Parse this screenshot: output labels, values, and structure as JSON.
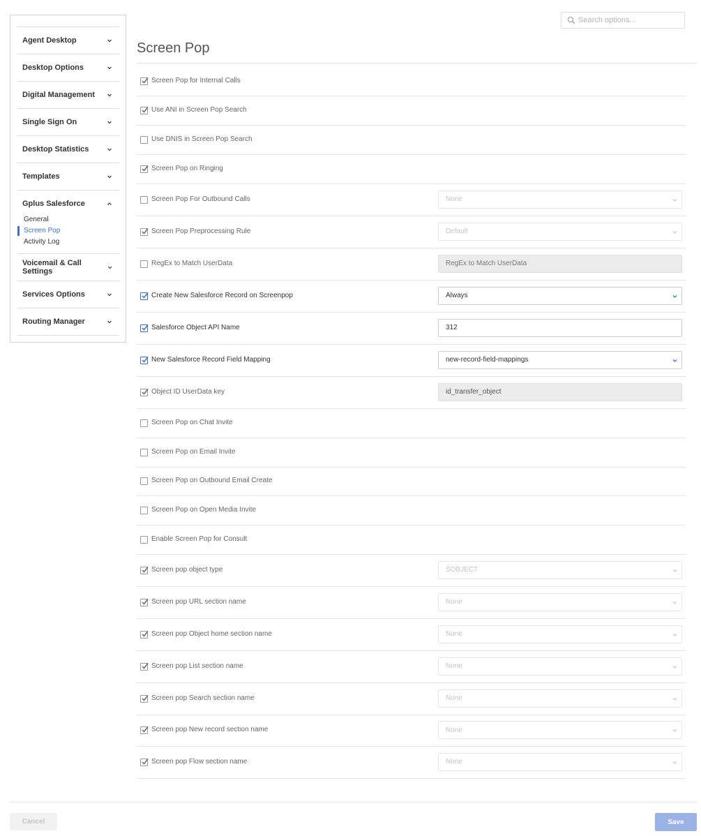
{
  "search": {
    "placeholder": "Search options..."
  },
  "sidebar": {
    "groups": [
      {
        "label": "Agent Desktop"
      },
      {
        "label": "Desktop Options"
      },
      {
        "label": "Digital Management"
      },
      {
        "label": "Single Sign On"
      },
      {
        "label": "Desktop Statistics"
      },
      {
        "label": "Templates"
      },
      {
        "label": "Gplus Salesforce",
        "expanded": true,
        "items": [
          "General",
          "Screen Pop",
          "Activity Log"
        ],
        "active_item": "Screen Pop"
      },
      {
        "label": "Voicemail & Call Settings"
      },
      {
        "label": "Services Options"
      },
      {
        "label": "Routing Manager"
      }
    ]
  },
  "main": {
    "title": "Screen Pop",
    "rows": [
      {
        "label": "Screen Pop for Internal Calls",
        "checked": true
      },
      {
        "label": "Use ANI in Screen Pop Search",
        "checked": true
      },
      {
        "label": "Use DNIS in Screen Pop Search",
        "checked": false
      },
      {
        "label": "Screen Pop on Ringing",
        "checked": true
      },
      {
        "label": "Screen Pop For Outbound Calls",
        "checked": false,
        "control": {
          "type": "select",
          "value": "None",
          "state": "disabled"
        }
      },
      {
        "label": "Screen Pop Preprocessing Rule",
        "checked": true,
        "control": {
          "type": "select",
          "value": "Default",
          "state": "disabled"
        }
      },
      {
        "label": "RegEx to Match UserData",
        "checked": false,
        "control": {
          "type": "input",
          "value": "",
          "placeholder": "RegEx to Match UserData",
          "state": "readonly"
        }
      },
      {
        "label": "Create New Salesforce Record on Screenpop",
        "checked": true,
        "control": {
          "type": "select",
          "value": "Always",
          "state": "active"
        }
      },
      {
        "label": "Salesforce Object API Name",
        "checked": true,
        "control": {
          "type": "input",
          "value": "312",
          "state": "active"
        }
      },
      {
        "label": "New Salesforce Record Field Mapping",
        "checked": true,
        "control": {
          "type": "select",
          "value": "new-record-field-mappings",
          "state": "active"
        }
      },
      {
        "label": "Object ID UserData key",
        "checked": true,
        "control": {
          "type": "input",
          "value": "id_transfer_object",
          "state": "readonly"
        }
      },
      {
        "label": "Screen Pop on Chat Invite",
        "checked": false
      },
      {
        "label": "Screen Pop on Email Invite",
        "checked": false
      },
      {
        "label": "Screen Pop on Outbound Email Create",
        "checked": false
      },
      {
        "label": "Screen Pop on Open Media Invite",
        "checked": false
      },
      {
        "label": "Enable Screen Pop for Consult",
        "checked": false
      },
      {
        "label": "Screen pop object type",
        "checked": true,
        "control": {
          "type": "select",
          "value": "SOBJECT",
          "state": "disabled"
        }
      },
      {
        "label": "Screen pop URL section name",
        "checked": true,
        "control": {
          "type": "select",
          "value": "None",
          "state": "disabled"
        }
      },
      {
        "label": "Screen pop Object home section name",
        "checked": true,
        "control": {
          "type": "select",
          "value": "None",
          "state": "disabled"
        }
      },
      {
        "label": "Screen pop List section name",
        "checked": true,
        "control": {
          "type": "select",
          "value": "None",
          "state": "disabled"
        }
      },
      {
        "label": "Screen pop Search section name",
        "checked": true,
        "control": {
          "type": "select",
          "value": "None",
          "state": "disabled"
        }
      },
      {
        "label": "Screen pop New record section name",
        "checked": true,
        "control": {
          "type": "select",
          "value": "None",
          "state": "disabled"
        }
      },
      {
        "label": "Screen pop Flow section name",
        "checked": true,
        "control": {
          "type": "select",
          "value": "None",
          "state": "disabled"
        }
      }
    ]
  },
  "footer": {
    "cancel_label": "Cancel",
    "save_label": "Save"
  },
  "colors": {
    "accent": "#3c6fd6",
    "save_button": "#9bb2e6"
  }
}
